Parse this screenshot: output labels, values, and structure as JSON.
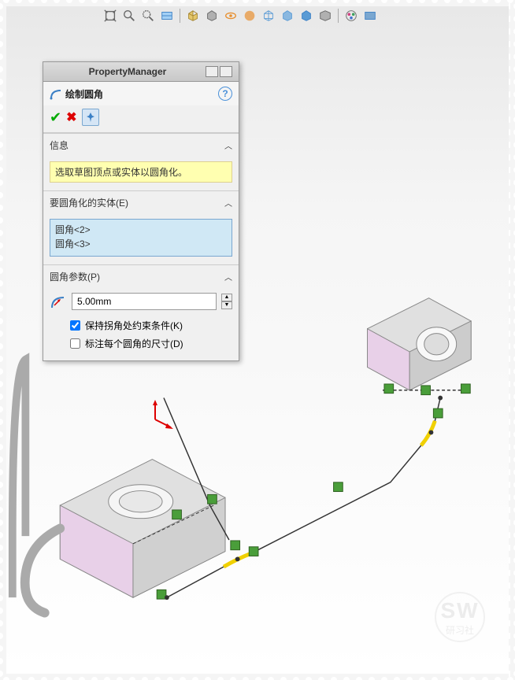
{
  "panel": {
    "title": "PropertyManager",
    "command": "绘制圆角",
    "help": "?",
    "sections": {
      "info": {
        "title": "信息",
        "message": "选取草图顶点或实体以圆角化。"
      },
      "entities": {
        "title": "要圆角化的实体(E)",
        "items": [
          "圆角<2>",
          "圆角<3>"
        ]
      },
      "params": {
        "title": "圆角参数(P)",
        "radius": "5.00mm",
        "keep_constraints_label": "保持拐角处约束条件(K)",
        "keep_constraints_checked": true,
        "dimension_each_label": "标注每个圆角的尺寸(D)",
        "dimension_each_checked": false
      }
    }
  },
  "watermark": {
    "line1": "SW",
    "line2": "研习社"
  }
}
